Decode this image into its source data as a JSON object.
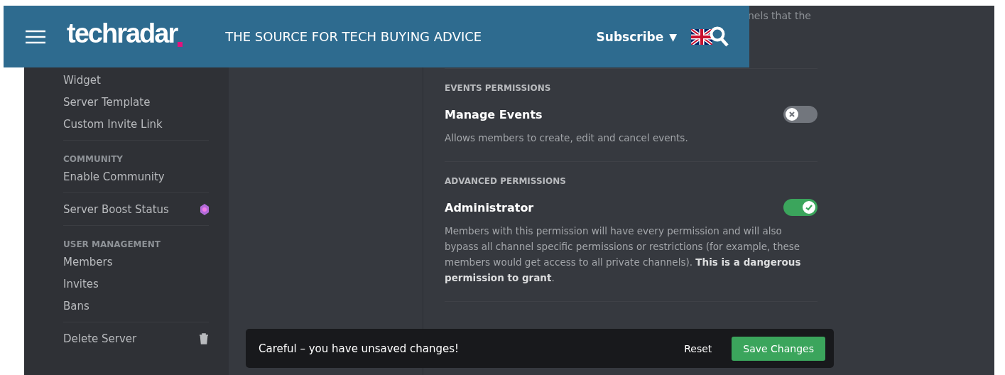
{
  "header": {
    "logo": "techradar",
    "tagline": "THE SOURCE FOR TECH BUYING ADVICE",
    "subscribe": "Subscribe",
    "subscribe_caret": "▼"
  },
  "sidebar": {
    "items": [
      {
        "kind": "item",
        "label": "Widget"
      },
      {
        "kind": "item",
        "label": "Server Template"
      },
      {
        "kind": "item",
        "label": "Custom Invite Link"
      },
      {
        "kind": "divider"
      },
      {
        "kind": "heading",
        "label": "COMMUNITY"
      },
      {
        "kind": "item",
        "label": "Enable Community"
      },
      {
        "kind": "divider"
      },
      {
        "kind": "boost",
        "label": "Server Boost Status"
      },
      {
        "kind": "divider"
      },
      {
        "kind": "heading",
        "label": "USER MANAGEMENT"
      },
      {
        "kind": "item",
        "label": "Members"
      },
      {
        "kind": "item",
        "label": "Invites"
      },
      {
        "kind": "item",
        "label": "Bans"
      },
      {
        "kind": "divider"
      },
      {
        "kind": "danger",
        "label": "Delete Server"
      }
    ]
  },
  "content": {
    "cut_text": "nels that the",
    "sections": [
      {
        "heading": "EVENTS PERMISSIONS",
        "permissions": [
          {
            "name": "Manage Events",
            "description": "Allows members to create, edit and cancel events.",
            "on": false
          }
        ]
      },
      {
        "heading": "ADVANCED PERMISSIONS",
        "permissions": [
          {
            "name": "Administrator",
            "description": "Members with this permission will have every permission and will also bypass all channel specific permissions or restrictions (for example, these members would get access to all private channels). **This is a dangerous permission to grant**.",
            "on": true
          }
        ]
      }
    ]
  },
  "toast": {
    "message": "Careful – you have unsaved changes!",
    "reset": "Reset",
    "save": "Save Changes"
  }
}
